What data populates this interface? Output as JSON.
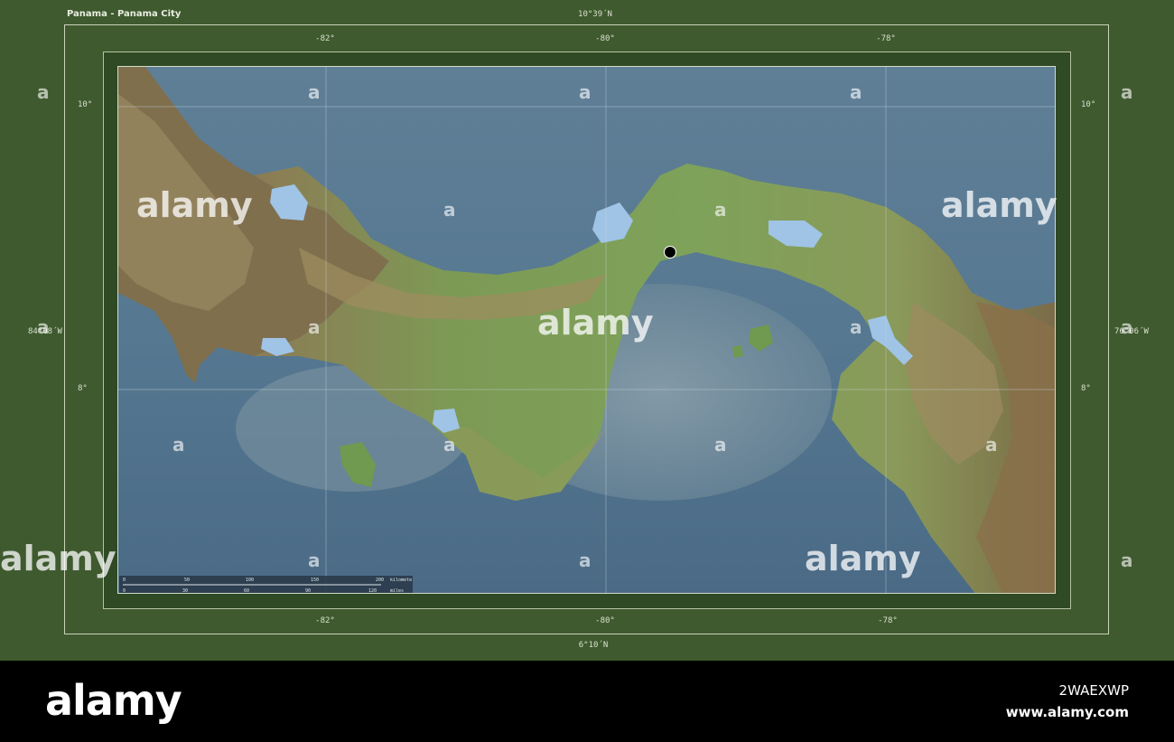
{
  "map": {
    "title": "Panama - Panama City",
    "lat_top": "10°39´N",
    "lat_bottom": "6°10´N",
    "lon_left": "84°08´W",
    "lon_right": "76°06´W",
    "lon_ticks": [
      "-82°",
      "-80°",
      "-78°"
    ],
    "lat_ticks": [
      "10°",
      "8°"
    ],
    "city_name": "Panama City",
    "scale": {
      "km_unit": "kilometers",
      "mi_unit": "miles",
      "km_ticks": [
        "0",
        "50",
        "100",
        "150",
        "200"
      ],
      "mi_ticks": [
        "0",
        "30",
        "60",
        "90",
        "120"
      ]
    }
  },
  "watermark": {
    "brand": "alamy",
    "tile_mark": "a"
  },
  "footer": {
    "logo": "alamy",
    "image_id": "2WAEXWP",
    "url": "www.alamy.com"
  },
  "colors": {
    "frame": "#3f5a2f",
    "sea": "#4f6d86",
    "lowland": "#6f9a4f",
    "highland": "#9a8a5e"
  },
  "icons": [
    "city-marker-icon"
  ]
}
